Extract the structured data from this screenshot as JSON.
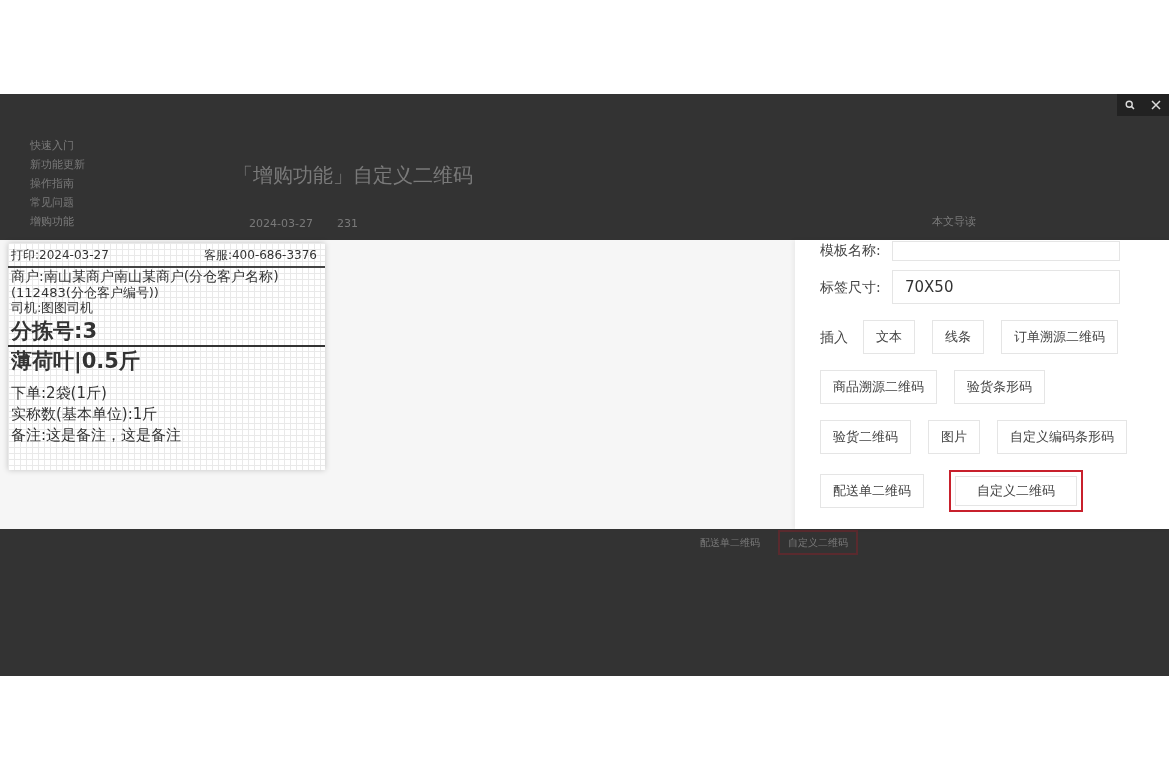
{
  "lightbox": {
    "toolbar": [
      {
        "kind": "search"
      },
      {
        "kind": "close"
      }
    ]
  },
  "background_page": {
    "sidebar": {
      "items": [
        "快速入门",
        "新功能更新",
        "操作指南",
        "常见问题",
        "增购功能"
      ]
    },
    "article": {
      "title": "「增购功能」自定义二维码",
      "date": "2024-03-27",
      "views": "231",
      "toc_title": "本文导读",
      "buttons": [
        {
          "label": "配送单二维码",
          "highlighted": false
        },
        {
          "label": "自定义二维码",
          "highlighted": true
        }
      ]
    }
  },
  "screenshot": {
    "label_preview": {
      "print_date": "打印:2024-03-27",
      "service": "客服:400-686-3376",
      "merchant": "商户:南山某商户南山某商户(分仓客户名称)",
      "customer_code": "(112483(分仓客户编号))",
      "driver": "司机:图图司机",
      "sort_number": "分拣号:3",
      "product": "薄荷叶|0.5斤",
      "lines": [
        "下单:2袋(1斤)",
        "实称数(基本单位):1斤",
        "备注:这是备注，这是备注"
      ]
    },
    "form": {
      "fields": [
        {
          "label": "模板名称:"
        },
        {
          "label": "标签尺寸:",
          "value": "70X50"
        }
      ],
      "insert_label": "插入",
      "insert_rows": [
        [
          {
            "label": "文本",
            "highlighted": false
          },
          {
            "label": "线条",
            "highlighted": false
          },
          {
            "label": "订单溯源二维码",
            "highlighted": false
          }
        ],
        [
          {
            "label": "商品溯源二维码",
            "highlighted": false
          },
          {
            "label": "验货条形码",
            "highlighted": false
          }
        ],
        [
          {
            "label": "验货二维码",
            "highlighted": false
          },
          {
            "label": "图片",
            "highlighted": false
          },
          {
            "label": "自定义编码条形码",
            "highlighted": false
          }
        ],
        [
          {
            "label": "配送单二维码",
            "highlighted": false
          },
          {
            "label": "自定义二维码",
            "highlighted": true
          }
        ]
      ]
    }
  }
}
